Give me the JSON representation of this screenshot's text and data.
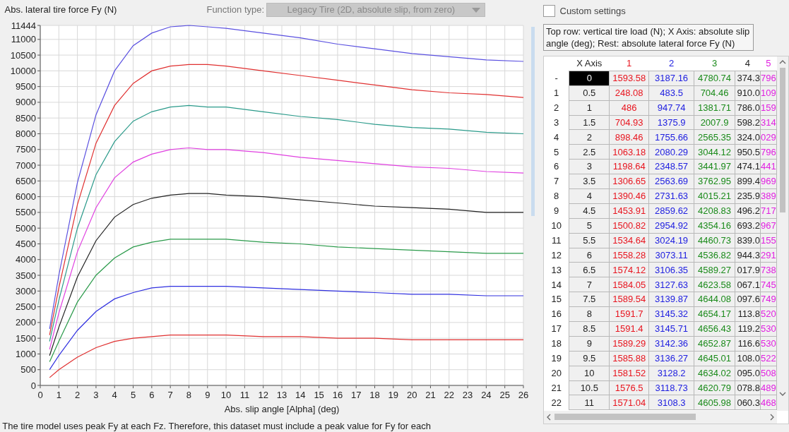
{
  "chart": {
    "chart_data": {
      "type": "line",
      "grid": true,
      "ylabel": "Abs. lateral tire force Fy (N)",
      "xlabel": "Abs. slip angle [Alpha] (deg)",
      "x": [
        0.5,
        1,
        2,
        3,
        4,
        5,
        6,
        7,
        8,
        9,
        10,
        12,
        14,
        16,
        18,
        20,
        22,
        24,
        26
      ],
      "xlim": [
        0,
        26
      ],
      "ylim": [
        0,
        11444
      ],
      "xticks": [
        0,
        1,
        2,
        3,
        4,
        5,
        6,
        7,
        8,
        9,
        10,
        11,
        12,
        13,
        14,
        15,
        16,
        17,
        18,
        19,
        20,
        21,
        22,
        23,
        24,
        25,
        26
      ],
      "yticks": [
        0,
        500,
        1000,
        1500,
        2000,
        2500,
        3000,
        3500,
        4000,
        4500,
        5000,
        5500,
        6000,
        6500,
        7000,
        7500,
        8000,
        8500,
        9000,
        9500,
        10000,
        10500,
        11000,
        11444
      ],
      "series": [
        {
          "color": "#e03030",
          "values": [
            250,
            500,
            900,
            1200,
            1400,
            1500,
            1550,
            1600,
            1600,
            1600,
            1600,
            1550,
            1550,
            1500,
            1500,
            1450,
            1450,
            1450,
            1450
          ]
        },
        {
          "color": "#3030e0",
          "values": [
            500,
            950,
            1750,
            2350,
            2750,
            2950,
            3100,
            3150,
            3150,
            3150,
            3150,
            3100,
            3050,
            3000,
            2950,
            2900,
            2900,
            2850,
            2850
          ]
        },
        {
          "color": "#2a9a4a",
          "values": [
            750,
            1400,
            2650,
            3500,
            4050,
            4400,
            4550,
            4650,
            4650,
            4650,
            4650,
            4550,
            4500,
            4400,
            4350,
            4300,
            4250,
            4200,
            4200
          ]
        },
        {
          "color": "#222222",
          "values": [
            950,
            1850,
            3450,
            4600,
            5350,
            5750,
            5950,
            6050,
            6100,
            6100,
            6050,
            6000,
            5900,
            5800,
            5700,
            5650,
            5600,
            5500,
            5500
          ]
        },
        {
          "color": "#e040e0",
          "values": [
            1150,
            2300,
            4250,
            5650,
            6600,
            7100,
            7350,
            7500,
            7550,
            7500,
            7500,
            7400,
            7250,
            7150,
            7050,
            6950,
            6900,
            6800,
            6750
          ]
        },
        {
          "color": "#2a9a8a",
          "values": [
            1400,
            2700,
            5000,
            6700,
            7750,
            8400,
            8700,
            8850,
            8900,
            8850,
            8850,
            8700,
            8550,
            8450,
            8300,
            8200,
            8150,
            8050,
            8000
          ]
        },
        {
          "color": "#e03030",
          "values": [
            1600,
            3100,
            5750,
            7700,
            8900,
            9600,
            10000,
            10150,
            10200,
            10200,
            10150,
            10000,
            9850,
            9700,
            9550,
            9400,
            9300,
            9250,
            9150
          ]
        },
        {
          "color": "#5a50e0",
          "values": [
            1800,
            3500,
            6450,
            8600,
            10000,
            10800,
            11200,
            11400,
            11444,
            11400,
            11350,
            11200,
            11050,
            10850,
            10700,
            10550,
            10450,
            10350,
            10300
          ]
        }
      ]
    }
  },
  "function_type": {
    "label": "Function type:",
    "value": "Legacy Tire (2D, absolute slip, from zero)",
    "disabled": true
  },
  "custom_settings": {
    "label": "Custom settings",
    "checked": false
  },
  "note": "Top row: vertical tire load (N); X Axis: absolute slip angle (deg); Rest: absolute lateral force Fy (N)",
  "table": {
    "columns": [
      {
        "label": "X Axis",
        "color": "#222222"
      },
      {
        "label": "1",
        "color": "#e8141e"
      },
      {
        "label": "2",
        "color": "#2020e0"
      },
      {
        "label": "3",
        "color": "#1a8a1a"
      },
      {
        "label": "4",
        "color": "#222222"
      },
      {
        "label": "5",
        "color": "#e020e0"
      }
    ],
    "rows": [
      {
        "label": "-",
        "selected": true,
        "cells": [
          "0",
          "1593.58",
          "3187.16",
          "4780.74",
          "374.3",
          "796"
        ]
      },
      {
        "label": "1",
        "selected": false,
        "cells": [
          "0.5",
          "248.08",
          "483.5",
          "704.46",
          "910.0",
          "109"
        ]
      },
      {
        "label": "2",
        "selected": false,
        "cells": [
          "1",
          "486",
          "947.74",
          "1381.71",
          "786.0",
          "159"
        ]
      },
      {
        "label": "3",
        "selected": false,
        "cells": [
          "1.5",
          "704.93",
          "1375.9",
          "2007.9",
          "598.2",
          "314"
        ]
      },
      {
        "label": "4",
        "selected": false,
        "cells": [
          "2",
          "898.46",
          "1755.66",
          "2565.35",
          "324.0",
          "029"
        ]
      },
      {
        "label": "5",
        "selected": false,
        "cells": [
          "2.5",
          "1063.18",
          "2080.29",
          "3044.12",
          "950.5",
          "796"
        ]
      },
      {
        "label": "6",
        "selected": false,
        "cells": [
          "3",
          "1198.64",
          "2348.57",
          "3441.97",
          "474.1",
          "441"
        ]
      },
      {
        "label": "7",
        "selected": false,
        "cells": [
          "3.5",
          "1306.65",
          "2563.69",
          "3762.95",
          "899.4",
          "969"
        ]
      },
      {
        "label": "8",
        "selected": false,
        "cells": [
          "4",
          "1390.46",
          "2731.63",
          "4015.21",
          "235.9",
          "389"
        ]
      },
      {
        "label": "9",
        "selected": false,
        "cells": [
          "4.5",
          "1453.91",
          "2859.62",
          "4208.83",
          "496.2",
          "717"
        ]
      },
      {
        "label": "10",
        "selected": false,
        "cells": [
          "5",
          "1500.82",
          "2954.92",
          "4354.16",
          "693.2",
          "967"
        ]
      },
      {
        "label": "11",
        "selected": false,
        "cells": [
          "5.5",
          "1534.64",
          "3024.19",
          "4460.73",
          "839.0",
          "155"
        ]
      },
      {
        "label": "12",
        "selected": false,
        "cells": [
          "6",
          "1558.28",
          "3073.11",
          "4536.82",
          "944.3",
          "291"
        ]
      },
      {
        "label": "13",
        "selected": false,
        "cells": [
          "6.5",
          "1574.12",
          "3106.35",
          "4589.27",
          "017.9",
          "738"
        ]
      },
      {
        "label": "14",
        "selected": false,
        "cells": [
          "7",
          "1584.05",
          "3127.63",
          "4623.58",
          "067.1",
          "745"
        ]
      },
      {
        "label": "15",
        "selected": false,
        "cells": [
          "7.5",
          "1589.54",
          "3139.87",
          "4644.08",
          "097.6",
          "749"
        ]
      },
      {
        "label": "16",
        "selected": false,
        "cells": [
          "8",
          "1591.7",
          "3145.32",
          "4654.17",
          "113.8",
          "520"
        ]
      },
      {
        "label": "17",
        "selected": false,
        "cells": [
          "8.5",
          "1591.4",
          "3145.71",
          "4656.43",
          "119.2",
          "530"
        ]
      },
      {
        "label": "18",
        "selected": false,
        "cells": [
          "9",
          "1589.29",
          "3142.36",
          "4652.87",
          "116.6",
          "530"
        ]
      },
      {
        "label": "19",
        "selected": false,
        "cells": [
          "9.5",
          "1585.88",
          "3136.27",
          "4645.01",
          "108.0",
          "522"
        ]
      },
      {
        "label": "20",
        "selected": false,
        "cells": [
          "10",
          "1581.52",
          "3128.2",
          "4634.02",
          "095.0",
          "508"
        ]
      },
      {
        "label": "21",
        "selected": false,
        "cells": [
          "10.5",
          "1576.5",
          "3118.73",
          "4620.79",
          "078.8",
          "489"
        ]
      },
      {
        "label": "22",
        "selected": false,
        "cells": [
          "11",
          "1571.04",
          "3108.3",
          "4605.98",
          "060.3",
          "468"
        ]
      }
    ]
  },
  "footer_text": "The tire model uses peak Fy at each Fz. Therefore, this dataset must include a peak value for Fy for each"
}
